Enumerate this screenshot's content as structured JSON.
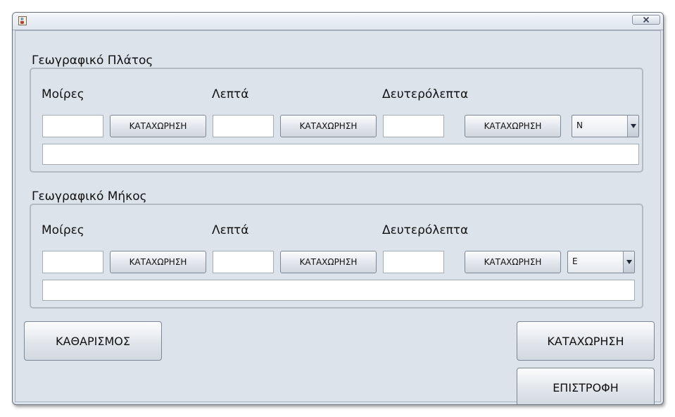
{
  "window": {
    "title": ""
  },
  "latitude": {
    "title": "Γεωγραφικό Πλάτος",
    "degrees_label": "Μοίρες",
    "minutes_label": "Λεπτά",
    "seconds_label": "Δευτερόλεπτα",
    "degrees_value": "",
    "minutes_value": "",
    "seconds_value": "",
    "degrees_button": "ΚΑΤΑΧΩΡΗΣΗ",
    "minutes_button": "ΚΑΤΑΧΩΡΗΣΗ",
    "seconds_button": "ΚΑΤΑΧΩΡΗΣΗ",
    "hemisphere": "N",
    "result": ""
  },
  "longitude": {
    "title": "Γεωγραφικό Μήκος",
    "degrees_label": "Μοίρες",
    "minutes_label": "Λεπτά",
    "seconds_label": "Δευτερόλεπτα",
    "degrees_value": "",
    "minutes_value": "",
    "seconds_value": "",
    "degrees_button": "ΚΑΤΑΧΩΡΗΣΗ",
    "minutes_button": "ΚΑΤΑΧΩΡΗΣΗ",
    "seconds_button": "ΚΑΤΑΧΩΡΗΣΗ",
    "hemisphere": "E",
    "result": ""
  },
  "actions": {
    "clear_label": "ΚΑΘΑΡΙΣΜΟΣ",
    "save_label": "ΚΑΤΑΧΩΡΗΣΗ",
    "back_label": "ΕΠΙΣΤΡΟΦΗ"
  },
  "icons": {
    "app": "java-cup-icon",
    "close": "close-icon",
    "dropdown": "chevron-down-icon"
  }
}
